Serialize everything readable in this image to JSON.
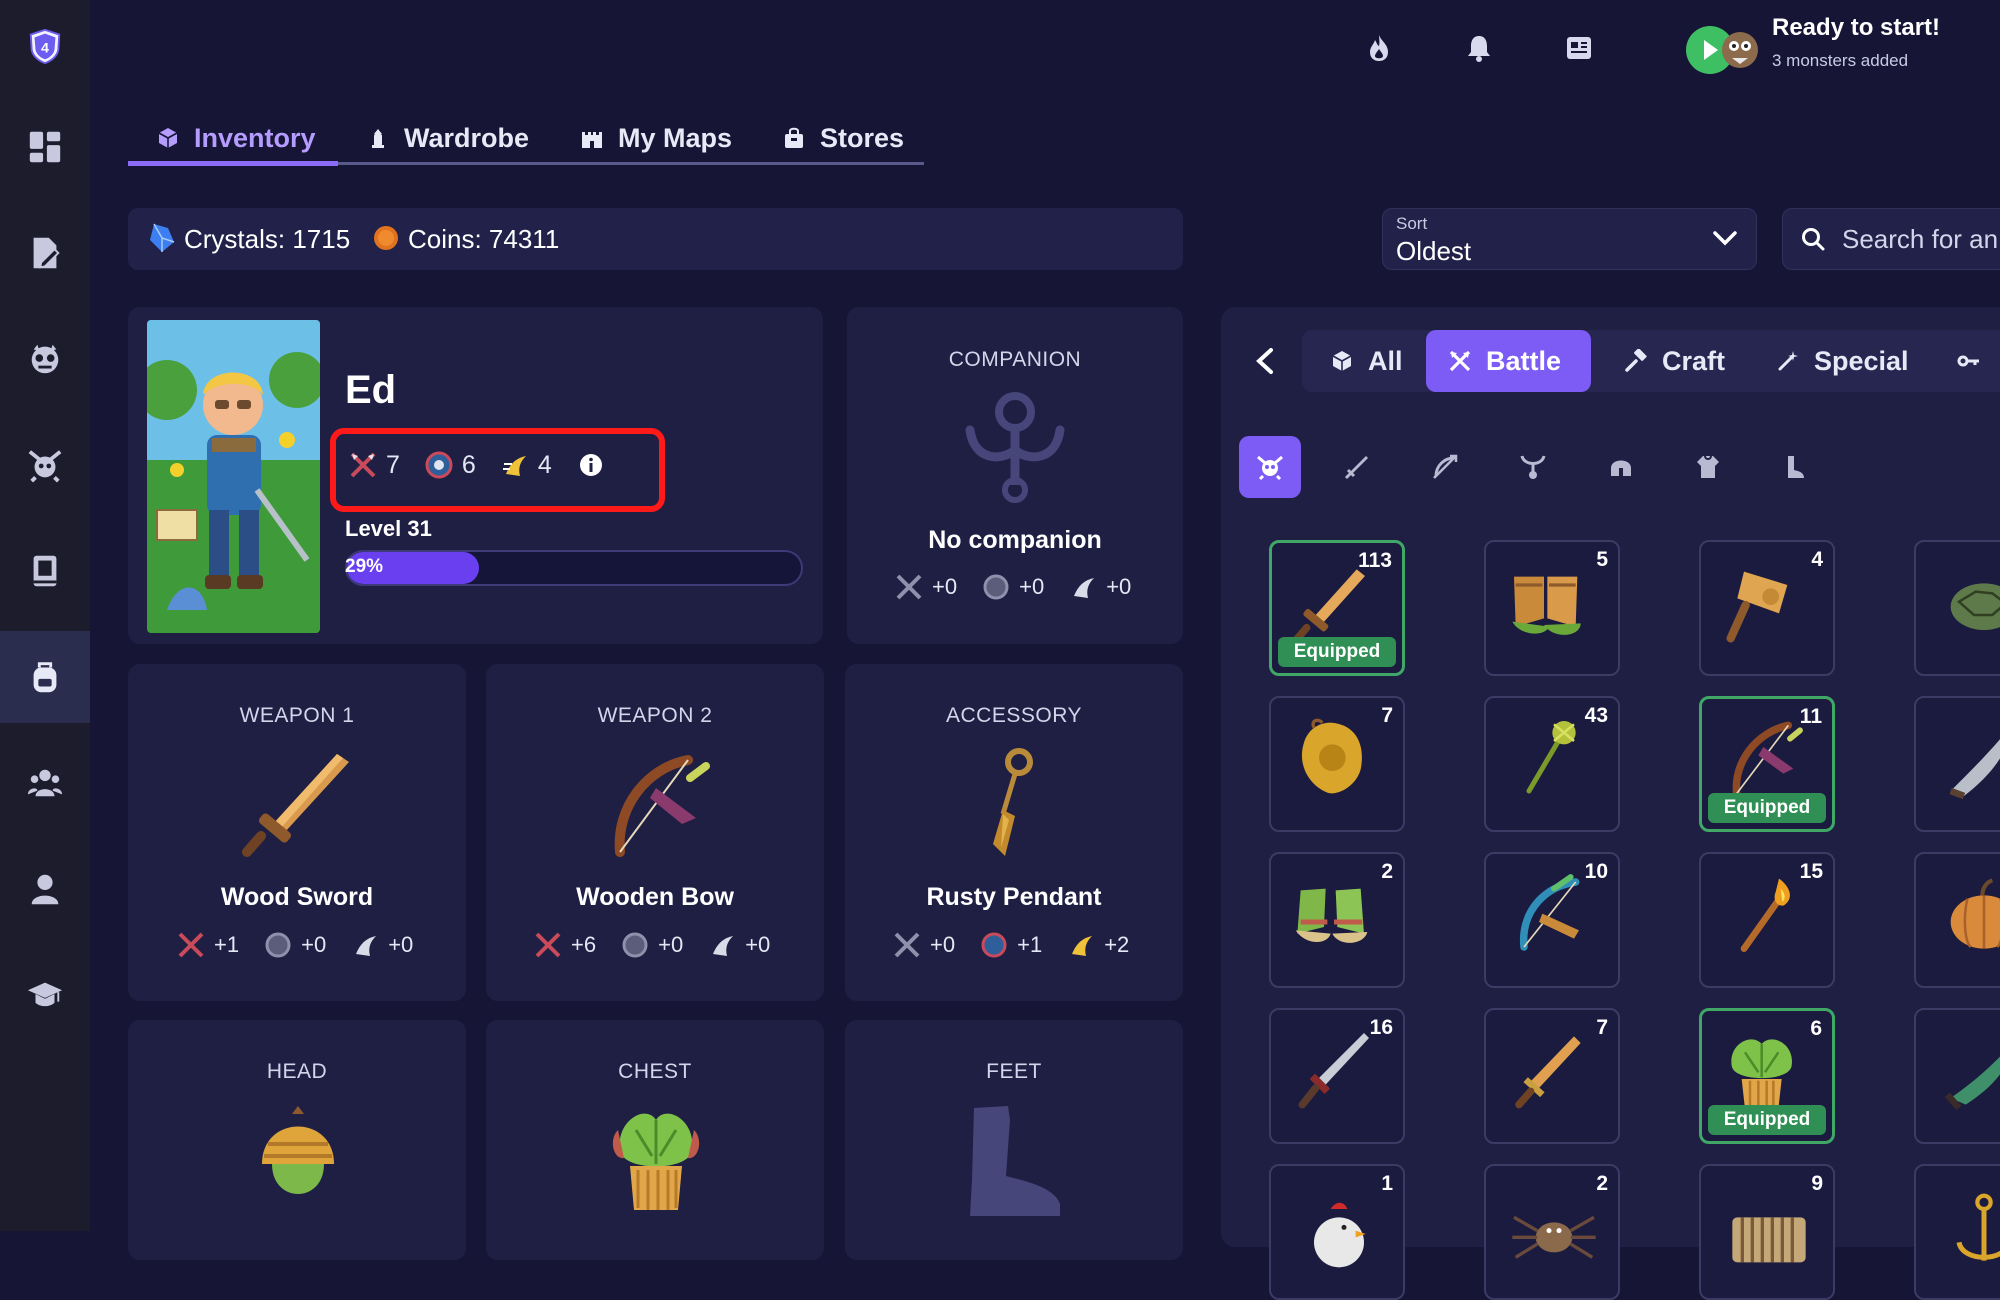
{
  "app": {
    "logo_number": "4",
    "colors": {
      "accent": "#8b6cf6",
      "panel": "#1f1f44",
      "background": "#161535",
      "equipped": "#2f8f55",
      "highlight_box": "#ff1a1a"
    }
  },
  "sidebar": {
    "items": [
      {
        "icon": "dashboard-icon"
      },
      {
        "icon": "assignment-icon"
      },
      {
        "icon": "monster-face-icon"
      },
      {
        "icon": "battle-monster-icon"
      },
      {
        "icon": "book-icon"
      },
      {
        "icon": "backpack-icon",
        "active": true
      },
      {
        "icon": "group-icon"
      },
      {
        "icon": "profile-icon"
      },
      {
        "icon": "graduation-cap-icon"
      }
    ]
  },
  "topbar": {
    "icons": [
      "streak-flame-icon",
      "notification-bell-icon",
      "news-icon"
    ],
    "status_title": "Ready to start!",
    "status_subtitle": "3 monsters added"
  },
  "tabs": [
    {
      "label": "Inventory",
      "icon": "cube-icon",
      "active": true
    },
    {
      "label": "Wardrobe",
      "icon": "hanger-icon"
    },
    {
      "label": "My Maps",
      "icon": "castle-icon"
    },
    {
      "label": "Stores",
      "icon": "shopping-bag-icon"
    }
  ],
  "currency": {
    "crystals": "Crystals: 1715",
    "coins": "Coins: 74311"
  },
  "sort": {
    "label": "Sort",
    "value": "Oldest"
  },
  "search": {
    "placeholder": "Search for an"
  },
  "hero": {
    "name": "Ed",
    "attack": "7",
    "defense": "6",
    "speed": "4",
    "level": "Level 31",
    "xp_percent_label": "29%",
    "xp_fraction": 0.29
  },
  "companion": {
    "label": "COMPANION",
    "name": "No companion",
    "stats": [
      "+0",
      "+0",
      "+0"
    ]
  },
  "slots": [
    {
      "label": "WEAPON 1",
      "name": "Wood Sword",
      "stats": [
        "+1",
        "+0",
        "+0"
      ]
    },
    {
      "label": "WEAPON 2",
      "name": "Wooden Bow",
      "stats": [
        "+6",
        "+0",
        "+0"
      ]
    },
    {
      "label": "ACCESSORY",
      "name": "Rusty Pendant",
      "stats": [
        "+0",
        "+1",
        "+2"
      ]
    },
    {
      "label": "HEAD"
    },
    {
      "label": "CHEST"
    },
    {
      "label": "FEET"
    }
  ],
  "categories": [
    {
      "label": "All",
      "icon": "cube-icon"
    },
    {
      "label": "Battle",
      "icon": "crossed-swords-icon",
      "active": true
    },
    {
      "label": "Craft",
      "icon": "hammer-icon"
    },
    {
      "label": "Special",
      "icon": "wand-icon"
    },
    {
      "label": "",
      "icon": "key-icon"
    }
  ],
  "sub_filters": [
    "monster-all-icon",
    "sword-filter-icon",
    "bow-filter-icon",
    "pendant-filter-icon",
    "helmet-filter-icon",
    "armor-filter-icon",
    "boot-filter-icon"
  ],
  "equipped_label": "Equipped",
  "items": [
    {
      "count": "113",
      "art": "sword",
      "equipped": true
    },
    {
      "count": "5",
      "art": "boots"
    },
    {
      "count": "4",
      "art": "hammer"
    },
    {
      "count": "",
      "art": "turtle"
    },
    {
      "count": "7",
      "art": "shield"
    },
    {
      "count": "43",
      "art": "staff"
    },
    {
      "count": "11",
      "art": "bow",
      "equipped": true
    },
    {
      "count": "",
      "art": "blade"
    },
    {
      "count": "2",
      "art": "boots-green"
    },
    {
      "count": "10",
      "art": "bow-blue"
    },
    {
      "count": "15",
      "art": "torch"
    },
    {
      "count": "",
      "art": "pumpkin"
    },
    {
      "count": "16",
      "art": "dagger"
    },
    {
      "count": "7",
      "art": "short-sword"
    },
    {
      "count": "6",
      "art": "cabbage-armor",
      "equipped": true
    },
    {
      "count": "",
      "art": "green-blade"
    },
    {
      "count": "1",
      "art": "rooster"
    },
    {
      "count": "2",
      "art": "spider"
    },
    {
      "count": "9",
      "art": "accordion"
    },
    {
      "count": "",
      "art": "anchor"
    }
  ]
}
